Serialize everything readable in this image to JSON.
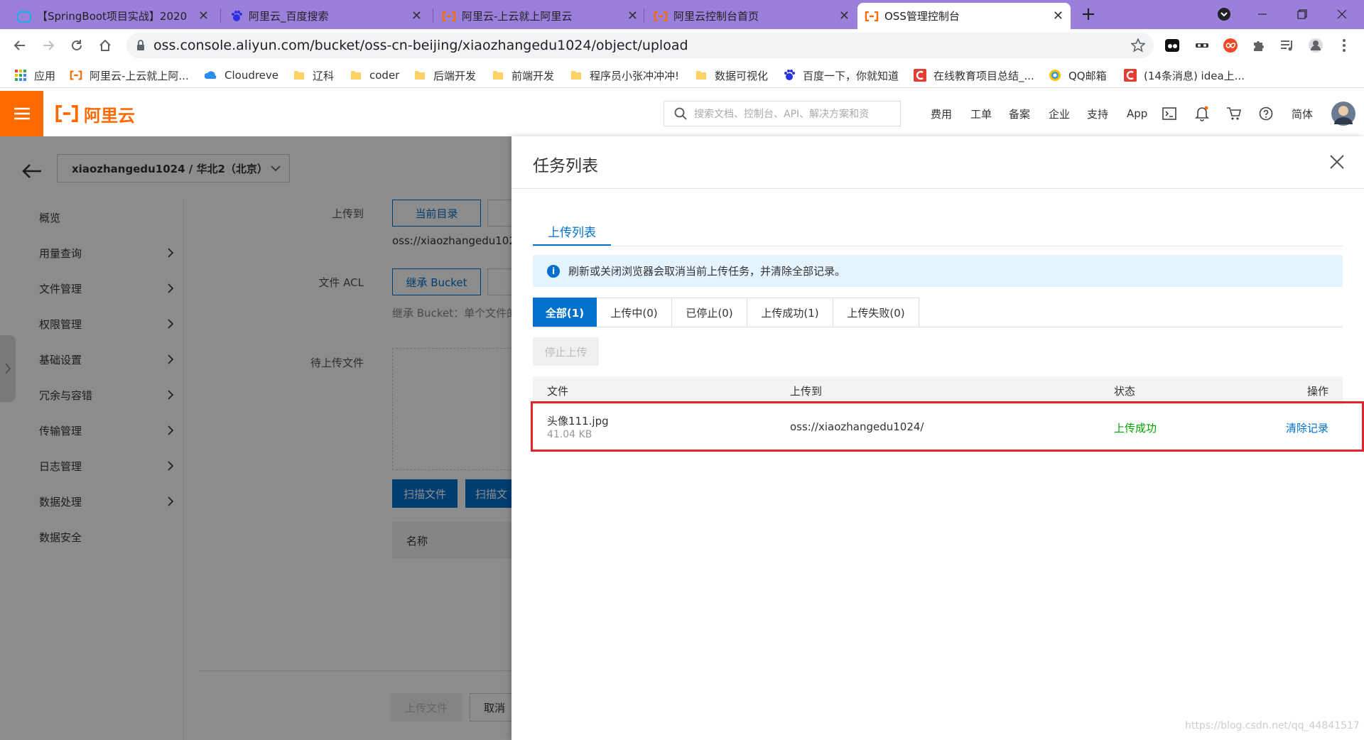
{
  "browser": {
    "tabs": [
      {
        "title": "【SpringBoot项目实战】2020",
        "active": false
      },
      {
        "title": "阿里云_百度搜索",
        "active": false
      },
      {
        "title": "阿里云-上云就上阿里云",
        "active": false
      },
      {
        "title": "阿里云控制台首页",
        "active": false
      },
      {
        "title": "OSS管理控制台",
        "active": true
      }
    ],
    "url": "oss.console.aliyun.com/bucket/oss-cn-beijing/xiaozhangedu1024/object/upload",
    "bookmarks": [
      {
        "label": "应用",
        "icon": "apps-icon"
      },
      {
        "label": "阿里云-上云就上阿...",
        "icon": "aliyun-icon"
      },
      {
        "label": "Cloudreve",
        "icon": "cloudreve-icon"
      },
      {
        "label": "辽科",
        "icon": "folder-icon"
      },
      {
        "label": "coder",
        "icon": "folder-icon"
      },
      {
        "label": "后端开发",
        "icon": "folder-icon"
      },
      {
        "label": "前端开发",
        "icon": "folder-icon"
      },
      {
        "label": "程序员小张冲冲冲!",
        "icon": "folder-icon"
      },
      {
        "label": "数据可视化",
        "icon": "folder-icon"
      },
      {
        "label": "百度一下，你就知道",
        "icon": "baidu-icon"
      },
      {
        "label": "在线教育项目总结_...",
        "icon": "csdn-icon"
      },
      {
        "label": "QQ邮箱",
        "icon": "qqmail-icon"
      },
      {
        "label": "(14条消息) idea上...",
        "icon": "csdn-icon"
      }
    ]
  },
  "console": {
    "logo": "阿里云",
    "search_placeholder": "搜索文档、控制台、API、解决方案和资",
    "nav": [
      "费用",
      "工单",
      "备案",
      "企业",
      "支持",
      "App"
    ],
    "lang": "简体"
  },
  "left": {
    "bucket": "xiaozhangedu1024 / 华北2（北京）",
    "menu": [
      "概览",
      "用量查询",
      "文件管理",
      "权限管理",
      "基础设置",
      "冗余与容错",
      "传输管理",
      "日志管理",
      "数据处理",
      "数据安全"
    ],
    "form": {
      "upload_to_label": "上传到",
      "current_dir": "当前目录",
      "upload_path": "oss://xiaozhangedu102",
      "acl_label": "文件 ACL",
      "acl_inherit": "继承 Bucket",
      "acl_hint": "继承 Bucket：单个文件的",
      "pending_label": "待上传文件",
      "scan_file": "扫描文件",
      "scan_folder": "扫描文",
      "name_col": "名称",
      "upload_btn": "上传文件",
      "cancel_btn": "取消"
    }
  },
  "drawer": {
    "title": "任务列表",
    "subtab": "上传列表",
    "notice": "刷新或关闭浏览器会取消当前上传任务，并清除全部记录。",
    "filters": [
      {
        "label": "全部(1)",
        "active": true
      },
      {
        "label": "上传中(0)",
        "active": false
      },
      {
        "label": "已停止(0)",
        "active": false
      },
      {
        "label": "上传成功(1)",
        "active": false
      },
      {
        "label": "上传失败(0)",
        "active": false
      }
    ],
    "stop_btn": "停止上传",
    "columns": {
      "file": "文件",
      "dest": "上传到",
      "status": "状态",
      "action": "操作"
    },
    "rows": [
      {
        "name": "头像111.jpg",
        "size": "41.04 KB",
        "dest": "oss://xiaozhangedu1024/",
        "status": "上传成功",
        "action": "清除记录"
      }
    ]
  },
  "watermark": "https://blog.csdn.net/qq_44841517",
  "colors": {
    "brand": "#ff6a00",
    "primary": "#0070cc",
    "success": "#00a700",
    "highlight": "#e0262c",
    "tabbar": "#9a80db"
  }
}
